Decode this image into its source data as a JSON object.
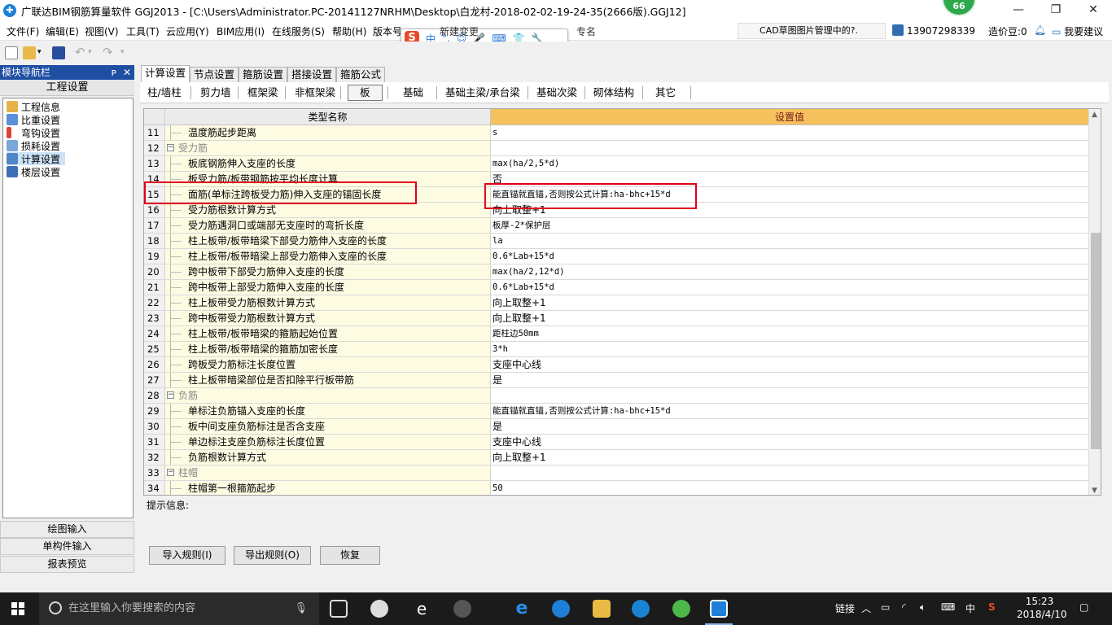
{
  "window": {
    "title": "广联达BIM钢筋算量软件 GGJ2013 - [C:\\Users\\Administrator.PC-20141127NRHM\\Desktop\\白龙村-2018-02-02-19-24-35(2666版).GGJ12]",
    "badge": "66",
    "minimize": "—",
    "maximize": "❐",
    "close": "✕"
  },
  "menu": {
    "items": [
      "文件(F)",
      "编辑(E)",
      "视图(V)",
      "工具(T)",
      "云应用(Y)",
      "BIM应用(I)",
      "在线服务(S)",
      "帮助(H)",
      "版本号"
    ],
    "hidden_partial_1": "新建变更",
    "hidden_partial_2": "专名",
    "cad_message": "CAD草图图片管理中的?.",
    "phone": "13907298339",
    "zaojiadou": "造价豆:0",
    "feedback": "我要建议"
  },
  "sogou": {
    "logo": "S",
    "items": [
      "中",
      "°,",
      "☺",
      "🎤",
      "⌨",
      "👕",
      "🔧"
    ]
  },
  "nav": {
    "title": "模块导航栏",
    "pin": "ᴘ",
    "close": "✕",
    "section": "工程设置",
    "tree": [
      "工程信息",
      "比重设置",
      "弯钩设置",
      "损耗设置",
      "计算设置",
      "楼层设置"
    ],
    "bottom": [
      "绘图输入",
      "单构件输入",
      "报表预览"
    ]
  },
  "main_tabs": [
    "计算设置",
    "节点设置",
    "箍筋设置",
    "搭接设置",
    "箍筋公式"
  ],
  "sub_tabs": [
    "柱/墙柱",
    "剪力墙",
    "框架梁",
    "非框架梁",
    "板",
    "基础",
    "基础主梁/承台梁",
    "基础次梁",
    "砌体结构",
    "其它"
  ],
  "grid": {
    "header_name": "类型名称",
    "header_value": "设置值",
    "rows": [
      {
        "n": "11",
        "name": "温度筋起步距离",
        "value": "s",
        "group": false
      },
      {
        "n": "12",
        "name": "受力筋",
        "value": "",
        "group": true
      },
      {
        "n": "13",
        "name": "板底钢筋伸入支座的长度",
        "value": "max(ha/2,5*d)",
        "group": false
      },
      {
        "n": "14",
        "name": "板受力筋/板带钢筋按平均长度计算",
        "value": "否",
        "group": false
      },
      {
        "n": "15",
        "name": "面筋(单标注跨板受力筋)伸入支座的锚固长度",
        "value": "能直锚就直锚,否则按公式计算:ha-bhc+15*d",
        "group": false
      },
      {
        "n": "16",
        "name": "受力筋根数计算方式",
        "value": "向上取整+1",
        "group": false
      },
      {
        "n": "17",
        "name": "受力筋遇洞口或端部无支座时的弯折长度",
        "value": "板厚-2*保护层",
        "group": false
      },
      {
        "n": "18",
        "name": "柱上板带/板带暗梁下部受力筋伸入支座的长度",
        "value": "la",
        "group": false
      },
      {
        "n": "19",
        "name": "柱上板带/板带暗梁上部受力筋伸入支座的长度",
        "value": "0.6*Lab+15*d",
        "group": false
      },
      {
        "n": "20",
        "name": "跨中板带下部受力筋伸入支座的长度",
        "value": "max(ha/2,12*d)",
        "group": false
      },
      {
        "n": "21",
        "name": "跨中板带上部受力筋伸入支座的长度",
        "value": "0.6*Lab+15*d",
        "group": false
      },
      {
        "n": "22",
        "name": "柱上板带受力筋根数计算方式",
        "value": "向上取整+1",
        "group": false
      },
      {
        "n": "23",
        "name": "跨中板带受力筋根数计算方式",
        "value": "向上取整+1",
        "group": false
      },
      {
        "n": "24",
        "name": "柱上板带/板带暗梁的箍筋起始位置",
        "value": "距柱边50mm",
        "group": false
      },
      {
        "n": "25",
        "name": "柱上板带/板带暗梁的箍筋加密长度",
        "value": "3*h",
        "group": false
      },
      {
        "n": "26",
        "name": "跨板受力筋标注长度位置",
        "value": "支座中心线",
        "group": false
      },
      {
        "n": "27",
        "name": "柱上板带暗梁部位是否扣除平行板带筋",
        "value": "是",
        "group": false
      },
      {
        "n": "28",
        "name": "负筋",
        "value": "",
        "group": true
      },
      {
        "n": "29",
        "name": "单标注负筋锚入支座的长度",
        "value": "能直锚就直锚,否则按公式计算:ha-bhc+15*d",
        "group": false
      },
      {
        "n": "30",
        "name": "板中间支座负筋标注是否含支座",
        "value": "是",
        "group": false
      },
      {
        "n": "31",
        "name": "单边标注支座负筋标注长度位置",
        "value": "支座中心线",
        "group": false
      },
      {
        "n": "32",
        "name": "负筋根数计算方式",
        "value": "向上取整+1",
        "group": false
      },
      {
        "n": "33",
        "name": "柱帽",
        "value": "",
        "group": true
      },
      {
        "n": "34",
        "name": "柱帽第一根箍筋起步",
        "value": "50",
        "group": false
      }
    ]
  },
  "hint_label": "提示信息:",
  "buttons": {
    "import": "导入规则(I)",
    "export": "导出规则(O)",
    "restore": "恢复"
  },
  "taskbar": {
    "search_placeholder": "在这里输入你要搜索的内容",
    "link_label": "链接",
    "ime": "中",
    "time": "15:23",
    "date": "2018/4/10"
  },
  "colors": {
    "accent": "#1e4fa3",
    "header_value": "#f6c25e",
    "name_cell": "#fefbe3",
    "highlight": "#e0001a"
  }
}
